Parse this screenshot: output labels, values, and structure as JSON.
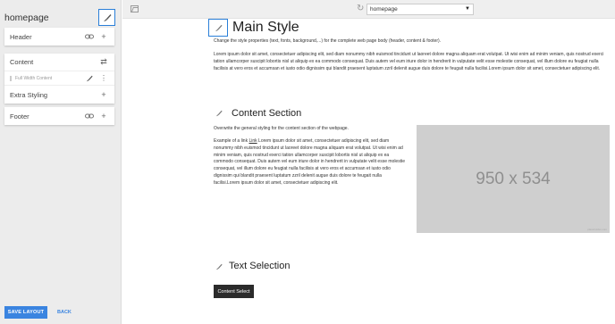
{
  "sidebar": {
    "title": "homepage",
    "sections": [
      {
        "label": "Header"
      },
      {
        "label": "Content",
        "sub_label": "Full Width Content",
        "extra_label": "Extra Styling"
      },
      {
        "label": "Footer"
      }
    ],
    "save_label": "SAVE LAYOUT",
    "back_label": "BACK"
  },
  "topbar": {
    "page_select": "homepage"
  },
  "main": {
    "title": "Main Style",
    "subtitle": "Change the style properties (text, fonts, background,...) for the complete web page body (header, content & footer).",
    "lorem": "Lorem ipsum dolor sit amet, consectetuer adipiscing elit, sed diam nonummy nibh euismod tincidunt ut laoreet dolore magna aliquam erat volutpat. Ut wisi enim ad minim veniam, quis nostrud exerci tation ullamcorper suscipit lobortis nisl ut aliquip ex ea commodo consequat. Duis autem vel eum iriure dolor in hendrerit in vulputate velit esse molestie consequat, vel illum dolore eu feugiat nulla facilisis at vero eros et accumsan et iusto odio dignissim qui blandit praesent luptatum zzril delenit augue duis dolore te feugait nulla facilisi.Lorem ipsum dolor sit amet, consectetuer adipiscing elit."
  },
  "content_section": {
    "title": "Content Section",
    "subtitle": "Overwrite the general styling for the content section of the webpage.",
    "example_prefix": "Example of a link ",
    "link_text": "Link",
    "body": " Lorem ipsum dolor sit amet, consectetuer adipiscing elit, sed diam nonummy nibh euismod tincidunt ut laoreet dolore magna aliquam erat volutpat. Ut wisi enim ad minim veniam, quis nostrud exerci tation ullamcorper suscipit lobortis nisl ut aliquip ex ea commodo consequat. Duis autem vel eum iriure dolor in hendrerit in vulputate velit esse molestie consequat, vel illum dolore eu feugiat nulla facilisis at vero eros et accumsan et iusto odio dignissim qui blandit praesent luptatum zzril delenit augue duis dolore te feugait nulla facilisi.Lorem ipsum dolor sit amet, consectetuer adipiscing elit.",
    "image_label": "950 x 534",
    "image_watermark": "placeholder.com"
  },
  "text_selection": {
    "title": "Text Selection",
    "button_label": "Content Select"
  },
  "colors": {
    "accent": "#2a7fd8",
    "button_blue": "#3a84e0",
    "dark_button": "#2b2b2b",
    "placeholder": "#cfcfcf"
  }
}
